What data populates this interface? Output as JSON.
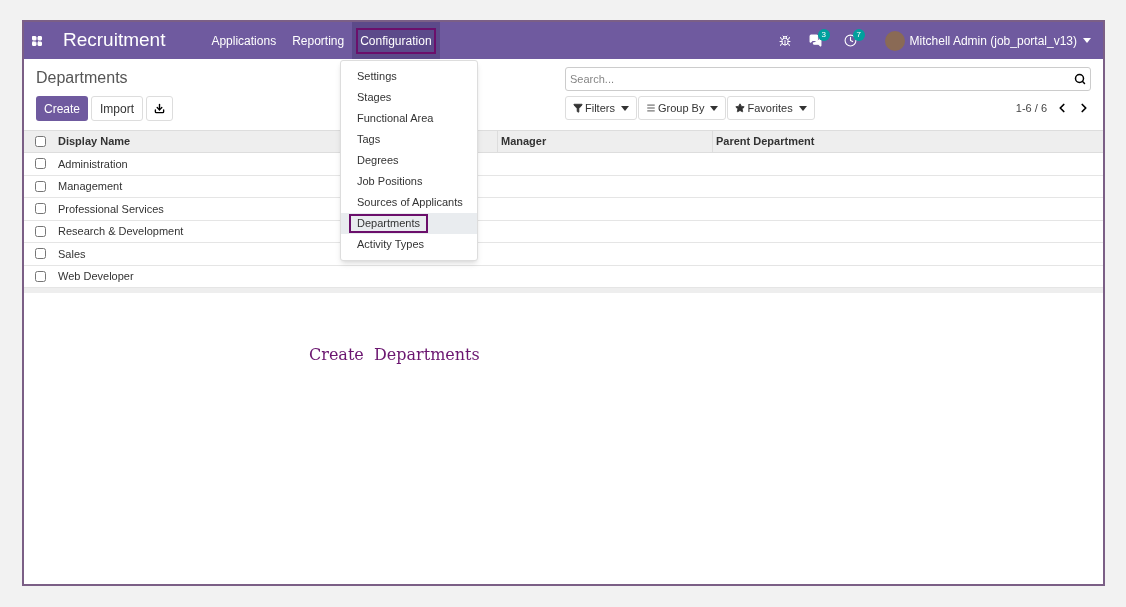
{
  "navbar": {
    "app_title": "Recruitment",
    "menus": [
      {
        "label": "Applications",
        "selected": false
      },
      {
        "label": "Reporting",
        "selected": false
      },
      {
        "label": "Configuration",
        "selected": true
      }
    ],
    "messages_badge": "3",
    "activities_badge": "7",
    "user": "Mitchell Admin (job_portal_v13)"
  },
  "dropdown": {
    "items": [
      {
        "label": "Settings",
        "selected": false
      },
      {
        "label": "Stages",
        "selected": false
      },
      {
        "label": "Functional Area",
        "selected": false
      },
      {
        "label": "Tags",
        "selected": false
      },
      {
        "label": "Degrees",
        "selected": false
      },
      {
        "label": "Job Positions",
        "selected": false
      },
      {
        "label": "Sources of Applicants",
        "selected": false
      },
      {
        "label": "Departments",
        "selected": true
      },
      {
        "label": "Activity Types",
        "selected": false
      }
    ]
  },
  "breadcrumb": "Departments",
  "buttons": {
    "create": "Create",
    "import": "Import"
  },
  "search": {
    "placeholder": "Search..."
  },
  "filters": [
    "Filters",
    "Group By",
    "Favorites"
  ],
  "pager": "1-6 / 6",
  "table": {
    "select_all_checked": false,
    "columns": [
      "Display Name",
      "Manager",
      "Parent Department"
    ],
    "rows": [
      {
        "name": "Administration",
        "checked": false
      },
      {
        "name": "Management",
        "checked": false
      },
      {
        "name": "Professional Services",
        "checked": false
      },
      {
        "name": "Research & Development",
        "checked": false
      },
      {
        "name": "Sales",
        "checked": false
      },
      {
        "name": "Web Developer",
        "checked": false
      }
    ]
  },
  "caption": "Create  Departments"
}
